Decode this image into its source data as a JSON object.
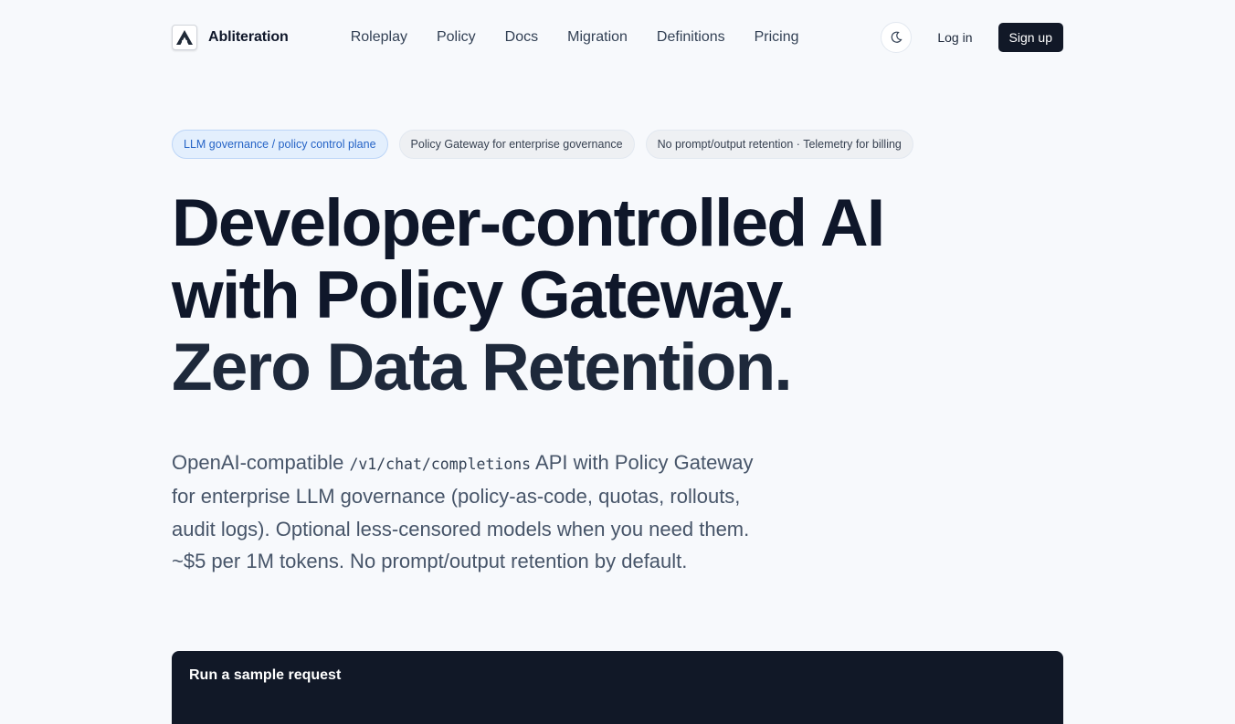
{
  "brand": {
    "name": "Abliteration",
    "logo_icon": "logo-a-icon"
  },
  "nav": [
    {
      "label": "Roleplay"
    },
    {
      "label": "Policy"
    },
    {
      "label": "Docs"
    },
    {
      "label": "Migration"
    },
    {
      "label": "Definitions"
    },
    {
      "label": "Pricing"
    }
  ],
  "header_actions": {
    "theme_icon": "moon-icon",
    "login_label": "Log in",
    "signup_label": "Sign up"
  },
  "pills": [
    {
      "label": "LLM governance / policy control plane"
    },
    {
      "label": "Policy Gateway for enterprise governance"
    },
    {
      "label": "No prompt/output retention · Telemetry for billing"
    }
  ],
  "hero": {
    "headline_lines": [
      "Developer-controlled AI",
      "with Policy Gateway.",
      "Zero Data Retention."
    ],
    "lead_prefix": "OpenAI-compatible ",
    "lead_code": "/v1/chat/completions",
    "lead_suffix": " API with Policy Gateway for enterprise LLM governance (policy-as-code, quotas, rollouts, audit logs). Optional less-censored models when you need them. ~$5 per 1M tokens. No prompt/output retention by default."
  },
  "sample_card": {
    "title": "Run a sample request"
  },
  "colors": {
    "background": "#f7f9fc",
    "text_primary": "#0f172a",
    "text_muted": "#475569",
    "accent_pill_bg": "#e3effd",
    "accent_pill_text": "#2563c6",
    "dark": "#111827"
  }
}
